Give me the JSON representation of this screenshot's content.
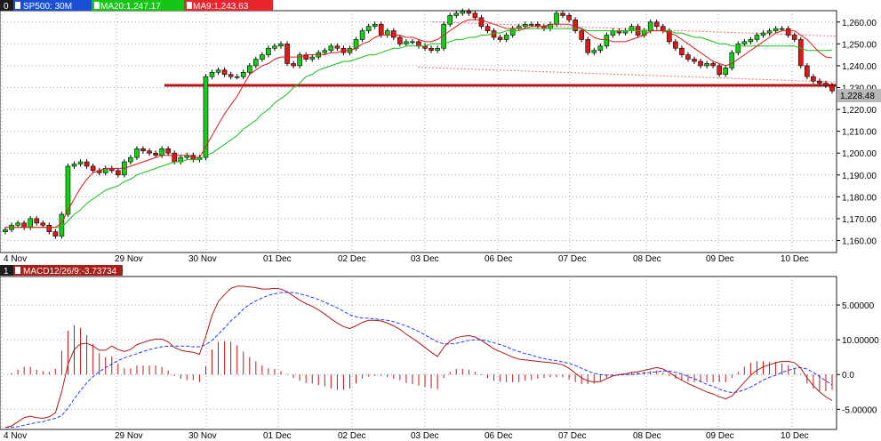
{
  "colors": {
    "background": "#ffffff",
    "grid": "#9aaab4",
    "panel_border": "#222222",
    "header_blue": "#1a4fd6",
    "header_green": "#16c616",
    "header_red": "#e8242c",
    "header_maroon": "#a8201c",
    "ma20": "#12c312",
    "ma9": "#e01818",
    "up_candle": "#12d012",
    "down_candle": "#e01818",
    "support": "#b81414",
    "channel": "#f07070",
    "macd_line": "#b01818",
    "signal_line": "#1c3cff",
    "histogram": "#c01818"
  },
  "price_panel": {
    "index_label": "0",
    "symbol_label": "SP500: 30M",
    "ma20_label": "MA20:1,247.17",
    "ma9_label": "MA9:1,243.63",
    "last_price_label": "1,228.48"
  },
  "macd_panel": {
    "index_label": "1",
    "title_label": "MACD12/26/9:-3.73734"
  },
  "x_axis": {
    "labels": [
      "4 Nov",
      "29 Nov",
      "30 Nov",
      "01 Dec",
      "02 Dec",
      "03 Dec",
      "06 Dec",
      "07 Dec",
      "08 Dec",
      "09 Dec",
      "10 Dec"
    ]
  },
  "chart_data": [
    {
      "type": "candlestick",
      "title": "SP500: 30M",
      "x_labels": [
        "4 Nov",
        "29 Nov",
        "30 Nov",
        "01 Dec",
        "02 Dec",
        "03 Dec",
        "06 Dec",
        "07 Dec",
        "08 Dec",
        "09 Dec",
        "10 Dec"
      ],
      "y_tick_labels": [
        "1,160.00",
        "1,170.00",
        "1,180.00",
        "1,190.00",
        "1,200.00",
        "1,210.00",
        "1,220.00",
        "1,230.00",
        "1,240.00",
        "1,250.00",
        "1,260.00"
      ],
      "y_ticks": [
        1160,
        1170,
        1180,
        1190,
        1200,
        1210,
        1220,
        1230,
        1240,
        1250,
        1260
      ],
      "ylim": [
        1154.5,
        1265.2
      ],
      "grid": true,
      "last_price": 1228.48,
      "support_level": 1231,
      "channel": {
        "start": [
          0,
          1267
        ],
        "end": [
          133,
          1253.5
        ],
        "lower_offset": -21
      },
      "series": [
        {
          "name": "MA20",
          "value": 1247.17
        },
        {
          "name": "MA9",
          "value": 1243.63
        }
      ],
      "close": [
        1165,
        1167,
        1168,
        1166,
        1170,
        1168,
        1167,
        1164,
        1162,
        1172,
        1194,
        1195,
        1196,
        1194,
        1192,
        1191,
        1193,
        1192,
        1190,
        1196,
        1198,
        1202,
        1201,
        1200,
        1199,
        1202,
        1200,
        1196,
        1198,
        1199,
        1197,
        1198,
        1235,
        1237,
        1238,
        1236,
        1235,
        1235,
        1237,
        1240,
        1243,
        1245,
        1248,
        1249,
        1250,
        1241,
        1240,
        1245,
        1243,
        1244,
        1246,
        1247,
        1249,
        1248,
        1246,
        1248,
        1252,
        1256,
        1258,
        1259,
        1254,
        1256,
        1253,
        1250,
        1251,
        1251,
        1249,
        1248,
        1247,
        1248,
        1259,
        1263,
        1264,
        1265,
        1264,
        1262,
        1258,
        1256,
        1253,
        1252,
        1254,
        1257,
        1258,
        1259,
        1259,
        1258,
        1257,
        1259,
        1264,
        1263,
        1261,
        1256,
        1252,
        1246,
        1247,
        1249,
        1254,
        1256,
        1255,
        1256,
        1258,
        1254,
        1256,
        1260,
        1258,
        1256,
        1251,
        1248,
        1245,
        1243,
        1242,
        1240,
        1241,
        1240,
        1236,
        1239,
        1246,
        1250,
        1251,
        1252,
        1254,
        1255,
        1256,
        1257,
        1257,
        1254,
        1252,
        1240,
        1235,
        1233,
        1232,
        1231,
        1228.48
      ],
      "ma20": [
        1166,
        1166,
        1166,
        1166,
        1166,
        1166,
        1166,
        1166,
        1166,
        1166,
        1169,
        1172,
        1174,
        1177,
        1179,
        1181,
        1183,
        1184,
        1185,
        1187,
        1188,
        1190,
        1191,
        1192,
        1193,
        1194,
        1195,
        1196,
        1196,
        1197,
        1197,
        1197,
        1199,
        1200,
        1202,
        1204,
        1206,
        1208,
        1211,
        1213,
        1215,
        1218,
        1220,
        1223,
        1225,
        1227,
        1230,
        1232,
        1235,
        1236,
        1238,
        1239,
        1240,
        1241,
        1242,
        1242,
        1243,
        1244,
        1245,
        1245,
        1246,
        1247,
        1248,
        1248,
        1249,
        1249,
        1249,
        1249,
        1250,
        1250,
        1250,
        1251,
        1252,
        1252,
        1253,
        1253,
        1254,
        1254,
        1255,
        1255,
        1256,
        1256,
        1256,
        1257,
        1257,
        1257,
        1257,
        1257,
        1257,
        1257,
        1257,
        1257,
        1257,
        1256,
        1256,
        1256,
        1256,
        1256,
        1256,
        1256,
        1256,
        1256,
        1256,
        1256,
        1256,
        1256,
        1256,
        1255,
        1255,
        1254,
        1253,
        1253,
        1252,
        1251,
        1250,
        1250,
        1249,
        1249,
        1249,
        1249,
        1249,
        1249,
        1249,
        1249,
        1249,
        1249,
        1249,
        1248,
        1247,
        1247,
        1247,
        1247,
        1247.17
      ],
      "ma9": [
        1166,
        1166,
        1166,
        1166,
        1166,
        1166,
        1166,
        1166,
        1166,
        1168,
        1174,
        1179,
        1184,
        1188,
        1191,
        1192,
        1193,
        1193,
        1193,
        1193,
        1194,
        1195,
        1196,
        1197,
        1198,
        1199,
        1199,
        1199,
        1199,
        1199,
        1198,
        1198,
        1203,
        1208,
        1213,
        1218,
        1222,
        1226,
        1231,
        1236,
        1238,
        1240,
        1241,
        1243,
        1244,
        1244,
        1244,
        1244,
        1245,
        1245,
        1245,
        1245,
        1246,
        1246,
        1247,
        1247,
        1248,
        1250,
        1251,
        1253,
        1254,
        1254,
        1254,
        1254,
        1253,
        1253,
        1252,
        1251,
        1251,
        1252,
        1254,
        1256,
        1258,
        1260,
        1261,
        1261,
        1261,
        1260,
        1259,
        1258,
        1257,
        1257,
        1257,
        1257,
        1258,
        1258,
        1258,
        1259,
        1259,
        1259,
        1259,
        1258,
        1257,
        1255,
        1253,
        1252,
        1252,
        1251,
        1251,
        1251,
        1252,
        1253,
        1254,
        1256,
        1256,
        1256,
        1255,
        1254,
        1252,
        1250,
        1248,
        1246,
        1244,
        1242,
        1241,
        1240,
        1241,
        1243,
        1245,
        1247,
        1249,
        1251,
        1253,
        1255,
        1256,
        1256,
        1256,
        1254,
        1252,
        1249,
        1246,
        1244,
        1243.63
      ]
    },
    {
      "type": "line",
      "title": "MACD12/26/9:-3.73734",
      "x_labels": [
        "4 Nov",
        "29 Nov",
        "30 Nov",
        "01 Dec",
        "02 Dec",
        "03 Dec",
        "06 Dec",
        "07 Dec",
        "08 Dec",
        "09 Dec",
        "10 Dec"
      ],
      "y_tick_labels": [
        "-5.00000",
        "0.0",
        "5.00000",
        "10.00000"
      ],
      "y_ticks": [
        -5,
        0,
        10,
        5
      ],
      "ylim": [
        -7.9,
        14.1
      ],
      "grid": true,
      "macd": [
        -7.6,
        -7.4,
        -6.8,
        -6.2,
        -6.0,
        -6.2,
        -6.3,
        -6.1,
        -5.5,
        -2.5,
        1.5,
        3.6,
        4.4,
        4.5,
        4.1,
        3.5,
        3.5,
        4.1,
        3.6,
        3.3,
        3.6,
        4.3,
        4.6,
        4.9,
        5.1,
        5.1,
        4.7,
        3.9,
        3.5,
        3.3,
        3.2,
        2.9,
        5.5,
        8.5,
        10.5,
        11.5,
        12.4,
        12.7,
        12.7,
        12.6,
        12.5,
        12.3,
        12.3,
        12.4,
        12.3,
        11.9,
        11.3,
        10.7,
        10.2,
        9.8,
        9.3,
        8.7,
        8.0,
        7.4,
        6.9,
        6.6,
        7.0,
        7.5,
        7.8,
        7.8,
        7.7,
        7.4,
        7.0,
        6.5,
        5.8,
        5.2,
        4.6,
        3.9,
        3.2,
        2.6,
        3.9,
        4.8,
        5.3,
        5.5,
        5.6,
        5.4,
        4.9,
        4.3,
        3.7,
        3.3,
        2.9,
        2.5,
        2.2,
        2.1,
        2.0,
        1.9,
        1.8,
        1.7,
        1.6,
        1.4,
        0.9,
        0.2,
        -0.5,
        -0.9,
        -1.1,
        -1.0,
        -0.6,
        -0.2,
        0.0,
        0.1,
        0.3,
        0.4,
        0.6,
        0.8,
        1.0,
        0.8,
        0.3,
        -0.3,
        -0.8,
        -1.3,
        -1.7,
        -2.1,
        -2.5,
        -2.8,
        -3.2,
        -3.5,
        -3.1,
        -2.1,
        -1.1,
        -0.1,
        0.6,
        1.1,
        1.4,
        1.7,
        1.9,
        1.9,
        1.7,
        0.9,
        -0.5,
        -1.6,
        -2.5,
        -3.2,
        -3.73734
      ],
      "signal": [
        -7.6,
        -7.6,
        -7.5,
        -7.3,
        -7.1,
        -6.9,
        -6.8,
        -6.5,
        -6.3,
        -5.9,
        -4.8,
        -3.5,
        -2.3,
        -1.2,
        -0.3,
        0.4,
        1.0,
        1.5,
        2.0,
        2.4,
        2.7,
        3.0,
        3.3,
        3.6,
        3.8,
        4.0,
        4.1,
        4.1,
        4.1,
        4.1,
        4.0,
        4.0,
        4.3,
        4.9,
        5.8,
        6.7,
        7.7,
        8.5,
        9.4,
        10.1,
        10.6,
        11.0,
        11.4,
        11.6,
        11.8,
        11.8,
        11.8,
        11.6,
        11.4,
        11.1,
        10.8,
        10.4,
        10.0,
        9.6,
        9.1,
        8.6,
        8.3,
        8.1,
        8.1,
        8.0,
        7.9,
        7.8,
        7.6,
        7.3,
        7.0,
        6.6,
        6.2,
        5.7,
        5.2,
        4.7,
        4.4,
        4.4,
        4.5,
        4.7,
        4.9,
        5.0,
        5.0,
        4.8,
        4.6,
        4.3,
        4.0,
        3.6,
        3.3,
        3.0,
        2.8,
        2.5,
        2.3,
        2.1,
        2.0,
        1.8,
        1.6,
        1.3,
        0.9,
        0.5,
        0.2,
        0.0,
        -0.1,
        -0.1,
        -0.1,
        0.0,
        0.0,
        0.1,
        0.2,
        0.3,
        0.4,
        0.5,
        0.5,
        0.3,
        0.1,
        -0.3,
        -0.6,
        -1.0,
        -1.4,
        -1.7,
        -2.1,
        -2.4,
        -2.6,
        -2.5,
        -2.2,
        -1.8,
        -1.3,
        -0.8,
        -0.4,
        -0.1,
        0.3,
        0.6,
        0.9,
        1.0,
        0.8,
        0.3,
        -0.3,
        -0.9,
        -1.5
      ],
      "histogram": [
        0.0,
        0.2,
        0.7,
        1.1,
        1.1,
        0.7,
        0.5,
        0.4,
        0.8,
        3.4,
        6.3,
        7.1,
        6.7,
        5.7,
        4.4,
        3.1,
        2.5,
        2.6,
        1.6,
        0.9,
        0.9,
        1.3,
        1.3,
        1.3,
        1.3,
        1.1,
        0.6,
        -0.2,
        -0.6,
        -0.8,
        -0.8,
        -1.1,
        1.2,
        3.6,
        4.7,
        4.8,
        4.7,
        4.2,
        3.3,
        2.5,
        1.9,
        1.3,
        0.9,
        0.8,
        0.5,
        0.1,
        -0.5,
        -0.9,
        -1.2,
        -1.3,
        -1.5,
        -1.7,
        -2.0,
        -2.2,
        -2.2,
        -2.0,
        -1.3,
        -0.6,
        -0.3,
        -0.2,
        -0.2,
        -0.4,
        -0.6,
        -0.8,
        -1.2,
        -1.4,
        -1.6,
        -1.8,
        -2.0,
        -2.1,
        -0.5,
        0.4,
        0.8,
        0.8,
        0.7,
        0.4,
        -0.1,
        -0.5,
        -0.9,
        -1.0,
        -1.1,
        -1.1,
        -1.1,
        -0.9,
        -0.8,
        -0.6,
        -0.5,
        -0.4,
        -0.4,
        -0.4,
        -0.7,
        -1.1,
        -1.4,
        -1.4,
        -1.3,
        -1.0,
        -0.5,
        -0.1,
        0.1,
        0.1,
        0.3,
        0.3,
        0.4,
        0.5,
        0.6,
        0.3,
        -0.2,
        -0.6,
        -0.9,
        -1.0,
        -1.1,
        -1.1,
        -1.1,
        -1.1,
        -1.1,
        -1.1,
        -0.5,
        0.4,
        1.1,
        1.7,
        1.9,
        1.9,
        1.8,
        1.8,
        1.6,
        1.3,
        0.9,
        0.1,
        -1.3,
        -2.0,
        -2.4,
        -2.4,
        -2.2
      ]
    }
  ]
}
